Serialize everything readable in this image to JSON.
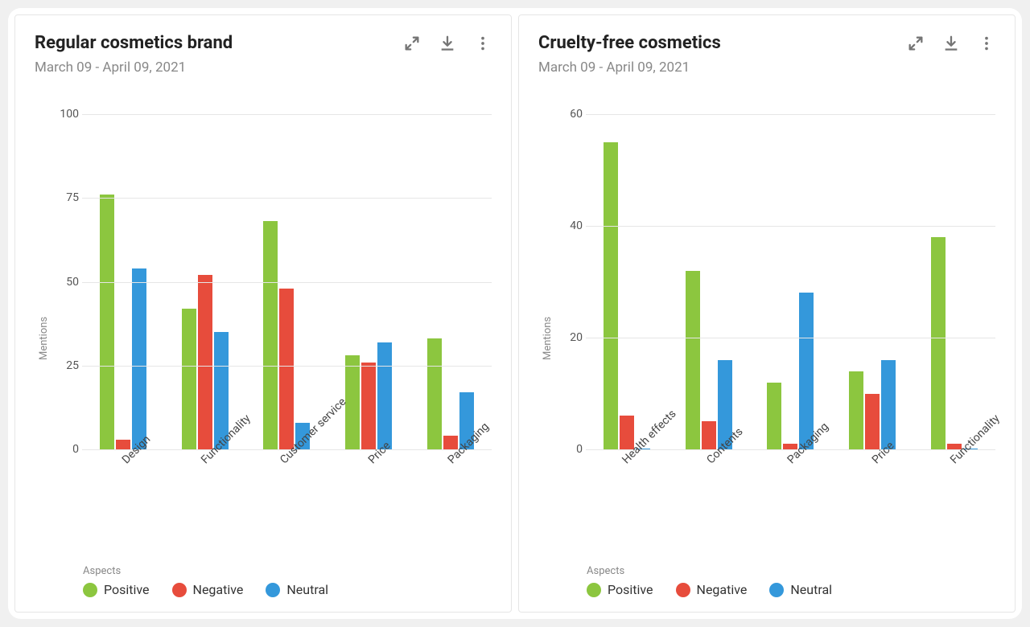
{
  "cards": [
    {
      "title": "Regular cosmetics brand",
      "subtitle": "March 09 - April 09, 2021",
      "ylabel": "Mentions",
      "legend_title": "Aspects",
      "legend": [
        "Positive",
        "Negative",
        "Neutral"
      ]
    },
    {
      "title": "Cruelty-free cosmetics",
      "subtitle": "March 09 - April 09, 2021",
      "ylabel": "Mentions",
      "legend_title": "Aspects",
      "legend": [
        "Positive",
        "Negative",
        "Neutral"
      ]
    }
  ],
  "chart_data": [
    {
      "type": "bar",
      "title": "Regular cosmetics brand",
      "ylabel": "Mentions",
      "xlabel": "",
      "ylim": [
        0,
        100
      ],
      "yticks": [
        0,
        25,
        50,
        75,
        100
      ],
      "categories": [
        "Design",
        "Functionality",
        "Customer service",
        "Price",
        "Packaging"
      ],
      "series": [
        {
          "name": "Positive",
          "color": "#8cc63f",
          "values": [
            76,
            42,
            68,
            28,
            33
          ]
        },
        {
          "name": "Negative",
          "color": "#e74c3c",
          "values": [
            3,
            52,
            48,
            26,
            4
          ]
        },
        {
          "name": "Neutral",
          "color": "#3498db",
          "values": [
            54,
            35,
            8,
            32,
            17
          ]
        }
      ]
    },
    {
      "type": "bar",
      "title": "Cruelty-free cosmetics",
      "ylabel": "Mentions",
      "xlabel": "",
      "ylim": [
        0,
        60
      ],
      "yticks": [
        0,
        20,
        40,
        60
      ],
      "categories": [
        "Health effects",
        "Contents",
        "Packaging",
        "Price",
        "Functionality"
      ],
      "series": [
        {
          "name": "Positive",
          "color": "#8cc63f",
          "values": [
            55,
            32,
            12,
            14,
            38
          ]
        },
        {
          "name": "Negative",
          "color": "#e74c3c",
          "values": [
            6,
            5,
            1,
            10,
            1
          ]
        },
        {
          "name": "Neutral",
          "color": "#3498db",
          "values": [
            0,
            16,
            28,
            16,
            0
          ]
        }
      ]
    }
  ]
}
